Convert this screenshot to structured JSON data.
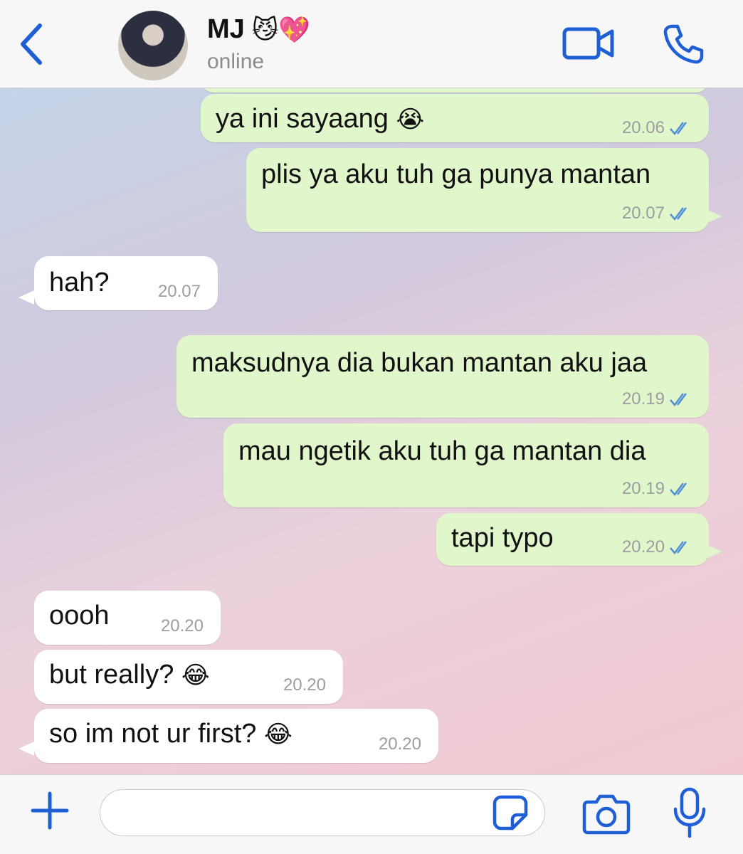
{
  "header": {
    "contact_name": "MJ",
    "name_emojis": "😼💖",
    "status": "online"
  },
  "messages": [
    {
      "dir": "out",
      "text": "ya ini sayaang",
      "emoji": "😭",
      "time": "20.06",
      "read": true
    },
    {
      "dir": "out",
      "text": "plis ya aku tuh ga punya mantan",
      "time": "20.07",
      "read": true
    },
    {
      "dir": "in",
      "text": "hah?",
      "time": "20.07"
    },
    {
      "dir": "out",
      "text": "maksudnya dia bukan mantan aku jaa",
      "time": "20.19",
      "read": true
    },
    {
      "dir": "out",
      "text": "mau ngetik aku tuh ga mantan dia",
      "time": "20.19",
      "read": true
    },
    {
      "dir": "out",
      "text": "tapi typo",
      "time": "20.20",
      "read": true
    },
    {
      "dir": "in",
      "text": "oooh",
      "time": "20.20"
    },
    {
      "dir": "in",
      "text": "but really?",
      "emoji": "😂",
      "time": "20.20"
    },
    {
      "dir": "in",
      "text": "so im not ur first?",
      "emoji": "😂",
      "time": "20.20"
    }
  ],
  "composer": {
    "placeholder": ""
  },
  "colors": {
    "accent": "#1f5fd6",
    "outgoing_bubble": "#e1f7cb",
    "incoming_bubble": "#ffffff",
    "read_ticks": "#4f8fd8"
  },
  "icons": [
    "back-chevron-icon",
    "video-call-icon",
    "phone-icon",
    "plus-icon",
    "sticker-icon",
    "camera-icon",
    "microphone-icon",
    "double-check-icon"
  ]
}
